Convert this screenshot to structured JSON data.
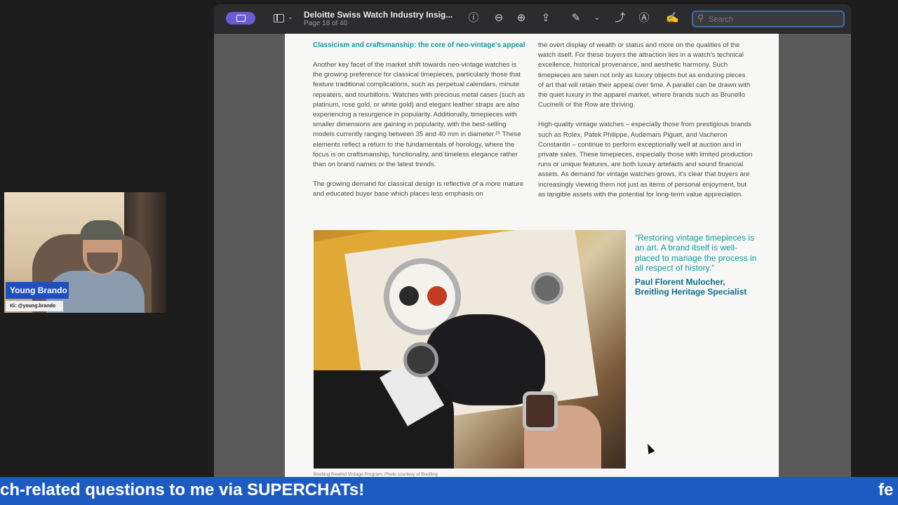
{
  "webcam": {
    "name": "Young Brando",
    "handle": "IG: @young.brando"
  },
  "window": {
    "doc_title": "Deloitte Swiss Watch Industry Insig...",
    "page_indicator": "Page 18 of 40",
    "search_placeholder": "Search",
    "toolbar_icons": [
      "sidebar-icon",
      "view-icon",
      "info-icon",
      "zoom-out-icon",
      "zoom-in-icon",
      "share-icon",
      "markup-icon",
      "chevron-down-icon",
      "rotate-icon",
      "annotate-icon",
      "signature-icon",
      "search-icon"
    ]
  },
  "document": {
    "heading": "Classicism and craftsmanship: the core of neo-vintage's appeal",
    "left_paragraphs": [
      "Another key facet of the market shift towards neo-vintage watches is the growing preference for classical timepieces, particularly those that feature traditional complications, such as perpetual calendars, minute repeaters, and tourbillons. Watches with precious metal cases (such as platinum, rose gold, or white gold) and elegant leather straps are also experiencing a resurgence in popularity. Additionally, timepieces with smaller dimensions are gaining in popularity, with the best-selling models currently ranging between 35 and 40 mm in diameter.²⁵ These elements reflect a return to the fundamentals of horology, where the focus is on craftsmanship, functionality, and timeless elegance rather than on brand names or the latest trends.",
      "The growing demand for classical design is reflective of a more mature and educated buyer base which places less emphasis on"
    ],
    "right_paragraphs": [
      "the overt display of wealth or status and more on the qualities of the watch itself. For these buyers the attraction lies in a watch's technical excellence, historical provenance, and aesthetic harmony. Such timepieces are seen not only as luxury objects but as enduring pieces of art that will retain their appeal over time. A parallel can be drawn with the quiet luxury in the apparel market, where brands such as Brunello Cucinelli or the Row are thriving.",
      "High-quality vintage watches – especially those from prestigious brands such as Rolex, Patek Philippe, Audemars Piguet, and Vacheron Constantin – continue to perform exceptionally well at auction and in private sales. These timepieces, especially those with limited production runs or unique features, are both luxury artefacts and sound financial assets. As demand for vintage watches grows, it's clear that buyers are increasingly viewing them not just as items of personal enjoyment, but as tangible assets with the potential for long-term value appreciation."
    ],
    "photo_caption": "Breitling Rewind Vintage Program. Photo courtesy of Breitling",
    "quote": "“Restoring vintage timepieces is an art. A brand itself is well-placed to manage the process in all respect of history.”",
    "quote_author": "Paul Florent Mulocher, Breitling Heritage Specialist"
  },
  "ticker": {
    "text": "ch-related questions to me via SUPERCHATs!",
    "next": "fe"
  },
  "colors": {
    "accent_teal": "#0e9aa3",
    "ticker_blue": "#1d5ac2",
    "sidebar_purple": "#6b5bd6"
  }
}
